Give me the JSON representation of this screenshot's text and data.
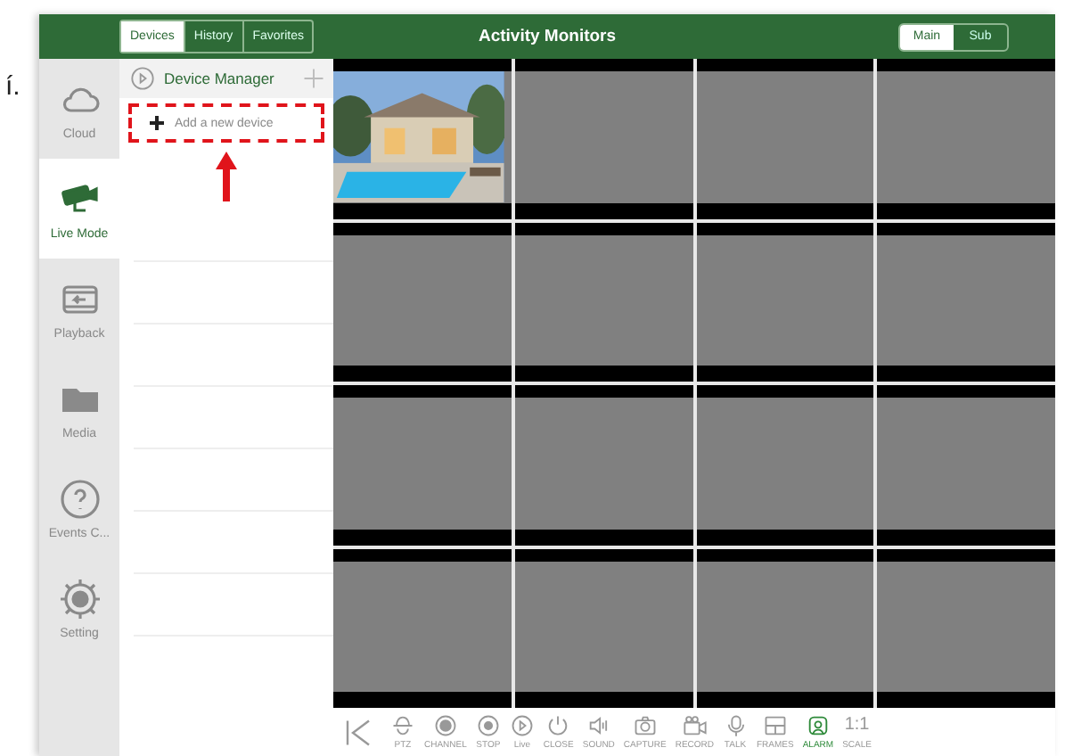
{
  "margin_text": "í.",
  "header": {
    "tabs": [
      {
        "label": "Devices",
        "selected": true
      },
      {
        "label": "History",
        "selected": false
      },
      {
        "label": "Favorites",
        "selected": false
      }
    ],
    "title": "Activity Monitors",
    "stream": [
      {
        "label": "Main",
        "selected": true
      },
      {
        "label": "Sub",
        "selected": false
      }
    ]
  },
  "sidebar": {
    "items": [
      {
        "label": "Cloud",
        "selected": false
      },
      {
        "label": "Live Mode",
        "selected": true
      },
      {
        "label": "Playback",
        "selected": false
      },
      {
        "label": "Media",
        "selected": false
      },
      {
        "label": "Events C...",
        "selected": false
      },
      {
        "label": "Setting",
        "selected": false
      }
    ]
  },
  "device_panel": {
    "title": "Device Manager",
    "add_item": "Add a new device",
    "highlighted": true
  },
  "monitors": [
    {
      "kind": "picture"
    },
    {
      "kind": "empty"
    },
    {
      "kind": "empty"
    },
    {
      "kind": "empty"
    },
    {
      "kind": "empty"
    },
    {
      "kind": "empty"
    },
    {
      "kind": "empty"
    },
    {
      "kind": "empty"
    },
    {
      "kind": "empty"
    },
    {
      "kind": "empty"
    },
    {
      "kind": "empty"
    },
    {
      "kind": "empty"
    },
    {
      "kind": "empty"
    },
    {
      "kind": "empty"
    },
    {
      "kind": "empty"
    },
    {
      "kind": "empty"
    }
  ],
  "toolbar": [
    {
      "label": "PTZ",
      "active": false
    },
    {
      "label": "CHANNEL",
      "active": false
    },
    {
      "label": "STOP",
      "active": false
    },
    {
      "label": "Live",
      "active": false
    },
    {
      "label": "CLOSE",
      "active": false
    },
    {
      "label": "SOUND",
      "active": false
    },
    {
      "label": "CAPTURE",
      "active": false
    },
    {
      "label": "RECORD",
      "active": false
    },
    {
      "label": "TALK",
      "active": false
    },
    {
      "label": "FRAMES",
      "active": false
    },
    {
      "label": "ALARM",
      "active": true
    },
    {
      "label": "SCALE",
      "active": false,
      "glyph": "1:1"
    }
  ]
}
